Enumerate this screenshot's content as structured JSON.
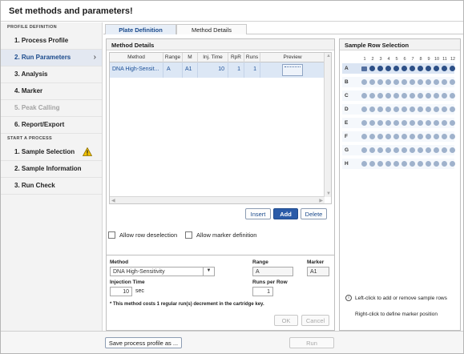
{
  "title": "Set methods and parameters!",
  "sidebar": {
    "section_profile": "PROFILE DEFINITION",
    "items": [
      {
        "label": "1. Process Profile"
      },
      {
        "label": "2. Run Parameters"
      },
      {
        "label": "3. Analysis"
      },
      {
        "label": "4. Marker"
      },
      {
        "label": "5. Peak Calling"
      },
      {
        "label": "6. Report/Export"
      }
    ],
    "section_start": "START A PROCESS",
    "start_items": [
      {
        "label": "1. Sample Selection"
      },
      {
        "label": "2. Sample Information"
      },
      {
        "label": "3. Run Check"
      }
    ],
    "chevron": "›"
  },
  "tabs": [
    {
      "label": "Plate Definition"
    },
    {
      "label": "Method Details"
    }
  ],
  "method_details": {
    "heading": "Method Details",
    "columns": [
      "Method",
      "Range",
      "M",
      "Inj. Time",
      "RpR",
      "Runs",
      "Preview"
    ],
    "row": {
      "method": "DNA High-Sensit...",
      "range": "A",
      "m": "A1",
      "inj_time": "10",
      "rpr": "1",
      "runs": "1"
    },
    "buttons": {
      "insert": "Insert",
      "add": "Add",
      "delete": "Delete"
    },
    "allow_row_deselection": "Allow row deselection",
    "allow_marker_definition": "Allow marker definition",
    "method_label": "Method",
    "method_value": "DNA High-Sensitivity",
    "dropdown_arrow": "▼",
    "range_label": "Range",
    "range_value": "A",
    "marker_label": "Marker",
    "marker_value": "A1",
    "injection_time_label": "Injection Time",
    "injection_time_value": "10",
    "injection_time_unit": "sec",
    "runs_per_row_label": "Runs per Row",
    "runs_per_row_value": "1",
    "note": "* This method costs 1 regular run(s) decrement in the cartridge key.",
    "ok": "OK",
    "cancel": "Cancel"
  },
  "sample_row_selection": {
    "heading": "Sample Row Selection",
    "columns": [
      "1",
      "2",
      "3",
      "4",
      "5",
      "6",
      "7",
      "8",
      "9",
      "10",
      "11",
      "12"
    ],
    "rows": [
      "A",
      "B",
      "C",
      "D",
      "E",
      "F",
      "G",
      "H"
    ],
    "selected_row": "A",
    "info_icon": "i",
    "info_line1": "Left-click to add or remove sample rows",
    "info_line2": "Right-click to define marker position"
  },
  "footer": {
    "save_profile": "Save process profile as ...",
    "run": "Run"
  },
  "colors": {
    "accent": "#2a5ba8",
    "selected_row": "#dbe5f3",
    "well_on": "#2c4f87",
    "well_off": "#9fb2cc",
    "warning": "#f2c200"
  }
}
